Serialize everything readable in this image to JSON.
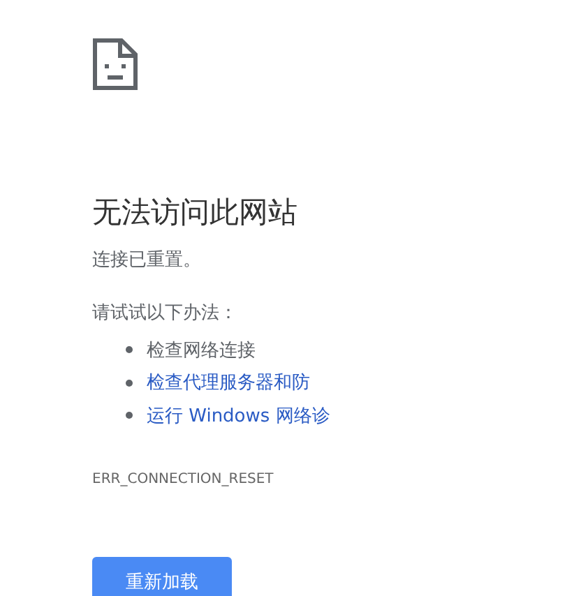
{
  "heading": "无法访问此网站",
  "message": "连接已重置。",
  "suggestions_intro": "请试试以下办法：",
  "suggestions": [
    {
      "text": "检查网络连接",
      "kind": "plain"
    },
    {
      "text": "检查代理服务器和防",
      "kind": "link"
    },
    {
      "text": "运行 Windows 网络诊",
      "kind": "link"
    }
  ],
  "error_code": "ERR_CONNECTION_RESET",
  "buttons": [
    {
      "label": "重新加载"
    }
  ]
}
